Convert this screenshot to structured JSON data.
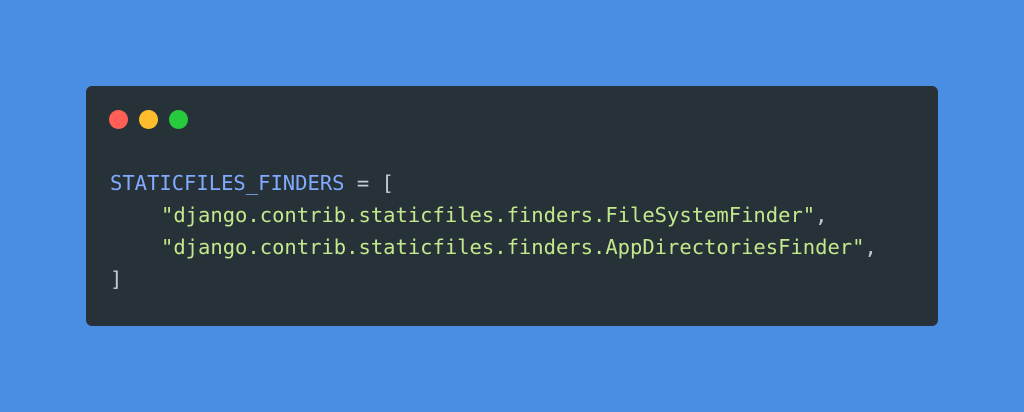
{
  "window": {
    "controls": [
      {
        "name": "close",
        "color": "#ff5f56"
      },
      {
        "name": "minimize",
        "color": "#ffbd2e"
      },
      {
        "name": "maximize",
        "color": "#27c93f"
      }
    ]
  },
  "colors": {
    "background": "#4a8ee3",
    "panel": "#263238",
    "identifier": "#82aaff",
    "operator": "#c3cbd4",
    "string": "#c3e88d",
    "punctuation": "#c3cbd4"
  },
  "code": {
    "identifier": "STATICFILES_FINDERS",
    "assign": " = ",
    "open_bracket": "[",
    "items": [
      "\"django.contrib.staticfiles.finders.FileSystemFinder\"",
      "\"django.contrib.staticfiles.finders.AppDirectoriesFinder\""
    ],
    "comma": ",",
    "close_bracket": "]"
  }
}
